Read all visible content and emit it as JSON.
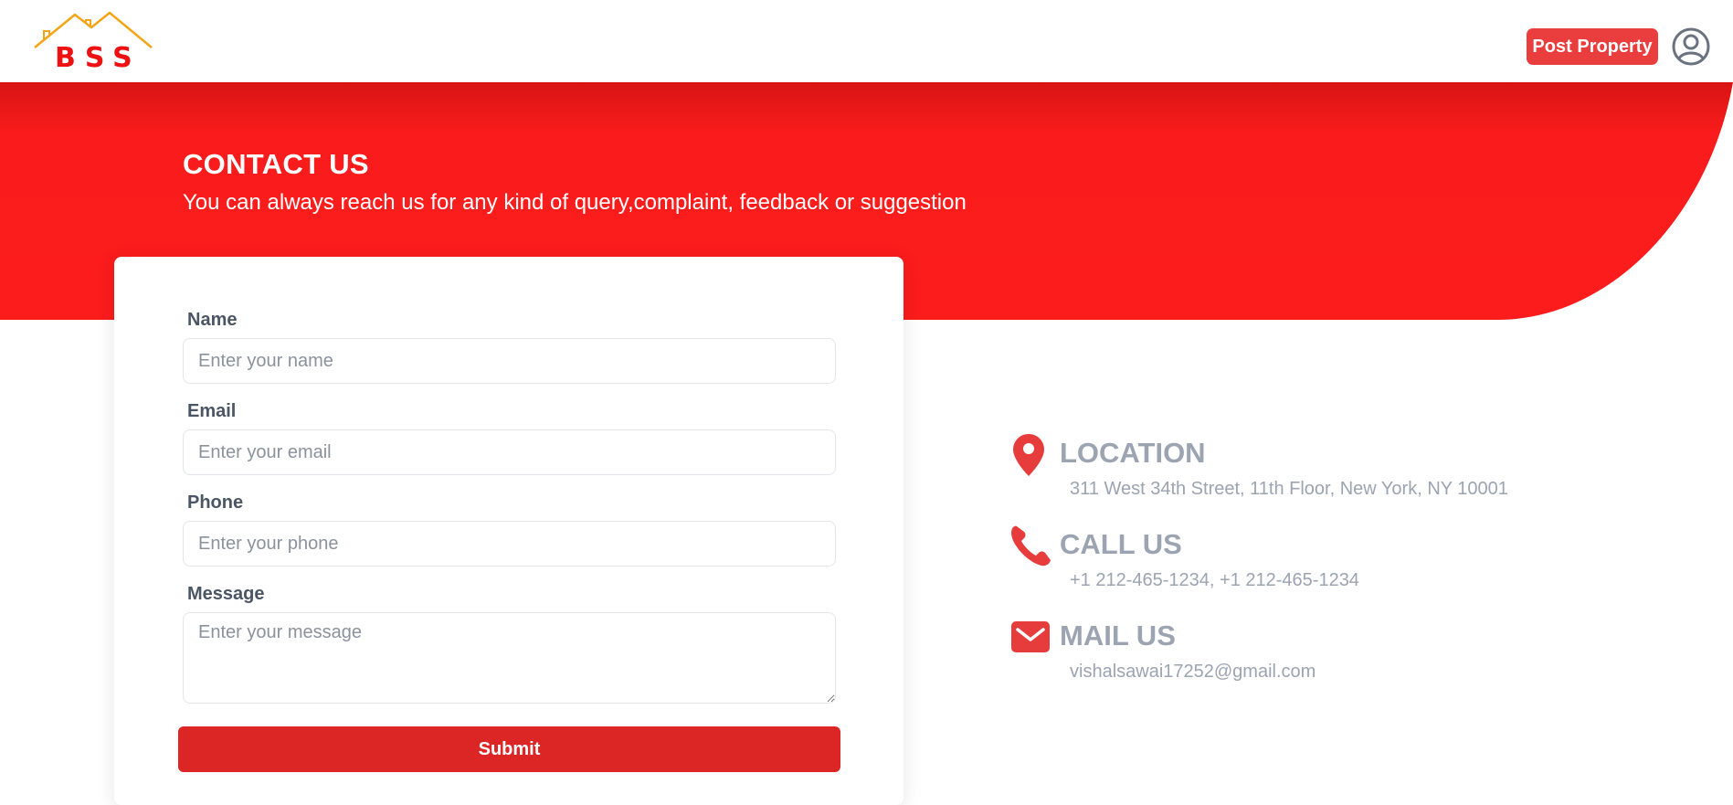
{
  "header": {
    "logo_text": "BSS",
    "post_property_label": "Post Property",
    "user_icon": "user-circle-icon"
  },
  "hero": {
    "title": "CONTACT US",
    "subtitle": "You can always reach us for any kind of query,complaint, feedback or suggestion"
  },
  "form": {
    "name": {
      "label": "Name",
      "placeholder": "Enter your name"
    },
    "email": {
      "label": "Email",
      "placeholder": "Enter your email"
    },
    "phone": {
      "label": "Phone",
      "placeholder": "Enter your phone"
    },
    "message": {
      "label": "Message",
      "placeholder": "Enter your message"
    },
    "submit_label": "Submit"
  },
  "contact": {
    "location": {
      "icon": "map-pin-icon",
      "title": "LOCATION",
      "text": "311 West 34th Street, 11th Floor, New York, NY 10001"
    },
    "call": {
      "icon": "phone-icon",
      "title": "CALL US",
      "text": "+1 212-465-1234, +1 212-465-1234"
    },
    "mail": {
      "icon": "envelope-icon",
      "title": "MAIL US",
      "text": "vishalsawai17252@gmail.com"
    }
  },
  "colors": {
    "brand_red": "#fc1c1c",
    "button_red": "#dc2626",
    "muted_text": "#9ca3b1",
    "icon_red": "#e63c3c"
  }
}
